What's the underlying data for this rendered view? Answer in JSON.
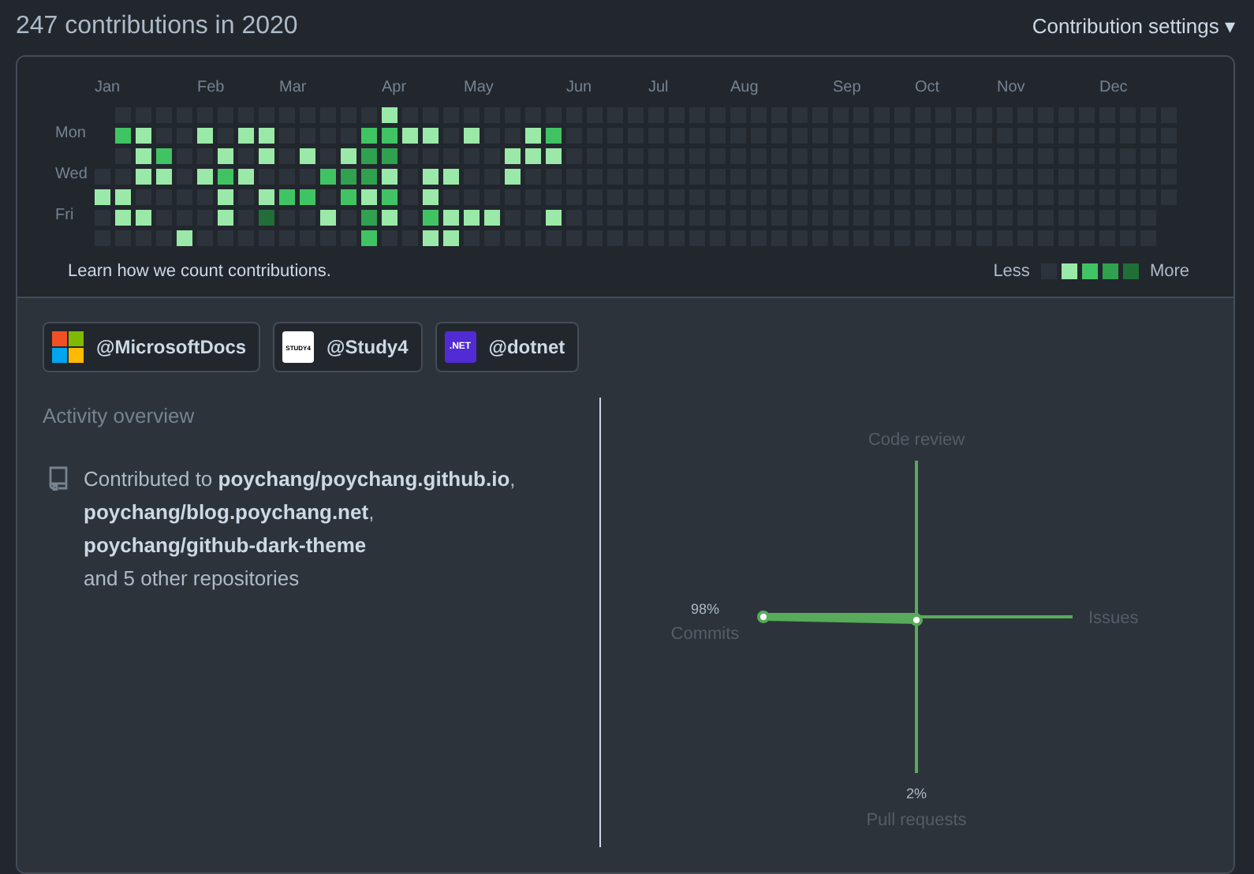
{
  "title": "247 contributions in 2020",
  "settings": {
    "label": "Contribution settings",
    "caret": "▾"
  },
  "calendar": {
    "day_labels": [
      "Mon",
      "Wed",
      "Fri"
    ],
    "weeks": [
      {
        "month": "Jan",
        "days": [
          {
            "color": "#2d333b"
          },
          {
            "color": "#9be9a8"
          },
          {
            "color": "#2d333b"
          },
          {
            "color": "#2d333b"
          }
        ]
      },
      {
        "days": [
          {
            "color": "#2d333b"
          },
          {
            "color": "#40c463"
          },
          {
            "color": "#2d333b"
          },
          {
            "color": "#2d333b"
          },
          {
            "color": "#9be9a8"
          },
          {
            "color": "#9be9a8"
          },
          {
            "color": "#2d333b"
          }
        ]
      },
      {
        "days": [
          {
            "color": "#2d333b"
          },
          {
            "color": "#9be9a8"
          },
          {
            "color": "#9be9a8"
          },
          {
            "color": "#9be9a8"
          },
          {
            "color": "#2d333b"
          },
          {
            "color": "#9be9a8"
          },
          {
            "color": "#2d333b"
          }
        ]
      },
      {
        "days": [
          {
            "color": "#2d333b"
          },
          {
            "color": "#2d333b"
          },
          {
            "color": "#40c463"
          },
          {
            "color": "#9be9a8"
          },
          {
            "color": "#2d333b"
          },
          {
            "color": "#2d333b"
          },
          {
            "color": "#2d333b"
          }
        ]
      },
      {
        "days": [
          {
            "color": "#2d333b"
          },
          {
            "color": "#2d333b"
          },
          {
            "color": "#2d333b"
          },
          {
            "color": "#2d333b"
          },
          {
            "color": "#2d333b"
          },
          {
            "color": "#2d333b"
          },
          {
            "color": "#9be9a8"
          }
        ]
      },
      {
        "month": "Feb",
        "days": [
          {
            "color": "#2d333b"
          },
          {
            "color": "#9be9a8"
          },
          {
            "color": "#2d333b"
          },
          {
            "color": "#9be9a8"
          },
          {
            "color": "#2d333b"
          },
          {
            "color": "#2d333b"
          },
          {
            "color": "#2d333b"
          }
        ]
      },
      {
        "days": [
          {
            "color": "#2d333b"
          },
          {
            "color": "#2d333b"
          },
          {
            "color": "#9be9a8"
          },
          {
            "color": "#40c463"
          },
          {
            "color": "#9be9a8"
          },
          {
            "color": "#9be9a8"
          },
          {
            "color": "#2d333b"
          }
        ]
      },
      {
        "days": [
          {
            "color": "#2d333b"
          },
          {
            "color": "#9be9a8"
          },
          {
            "color": "#2d333b"
          },
          {
            "color": "#9be9a8"
          },
          {
            "color": "#2d333b"
          },
          {
            "color": "#2d333b"
          },
          {
            "color": "#2d333b"
          }
        ]
      },
      {
        "days": [
          {
            "color": "#2d333b"
          },
          {
            "color": "#9be9a8"
          },
          {
            "color": "#9be9a8"
          },
          {
            "color": "#2d333b"
          },
          {
            "color": "#9be9a8"
          },
          {
            "color": "#216e39"
          },
          {
            "color": "#2d333b"
          }
        ]
      },
      {
        "month": "Mar",
        "days": [
          {
            "color": "#2d333b"
          },
          {
            "color": "#2d333b"
          },
          {
            "color": "#2d333b"
          },
          {
            "color": "#2d333b"
          },
          {
            "color": "#40c463"
          },
          {
            "color": "#2d333b"
          },
          {
            "color": "#2d333b"
          }
        ]
      },
      {
        "days": [
          {
            "color": "#2d333b"
          },
          {
            "color": "#2d333b"
          },
          {
            "color": "#9be9a8"
          },
          {
            "color": "#2d333b"
          },
          {
            "color": "#40c463"
          },
          {
            "color": "#2d333b"
          },
          {
            "color": "#2d333b"
          }
        ]
      },
      {
        "days": [
          {
            "color": "#2d333b"
          },
          {
            "color": "#2d333b"
          },
          {
            "color": "#2d333b"
          },
          {
            "color": "#40c463"
          },
          {
            "color": "#2d333b"
          },
          {
            "color": "#9be9a8"
          },
          {
            "color": "#2d333b"
          }
        ]
      },
      {
        "days": [
          {
            "color": "#2d333b"
          },
          {
            "color": "#2d333b"
          },
          {
            "color": "#9be9a8"
          },
          {
            "color": "#30a14e"
          },
          {
            "color": "#40c463"
          },
          {
            "color": "#2d333b"
          },
          {
            "color": "#2d333b"
          }
        ]
      },
      {
        "days": [
          {
            "color": "#2d333b"
          },
          {
            "color": "#40c463"
          },
          {
            "color": "#30a14e"
          },
          {
            "color": "#30a14e"
          },
          {
            "color": "#9be9a8"
          },
          {
            "color": "#30a14e"
          },
          {
            "color": "#40c463"
          }
        ]
      },
      {
        "month": "Apr",
        "days": [
          {
            "color": "#9be9a8"
          },
          {
            "color": "#40c463"
          },
          {
            "color": "#30a14e"
          },
          {
            "color": "#9be9a8"
          },
          {
            "color": "#40c463"
          },
          {
            "color": "#9be9a8"
          },
          {
            "color": "#2d333b"
          }
        ]
      },
      {
        "days": [
          {
            "color": "#2d333b"
          },
          {
            "color": "#9be9a8"
          },
          {
            "color": "#2d333b"
          },
          {
            "color": "#2d333b"
          },
          {
            "color": "#2d333b"
          },
          {
            "color": "#2d333b"
          },
          {
            "color": "#2d333b"
          }
        ]
      },
      {
        "days": [
          {
            "color": "#2d333b"
          },
          {
            "color": "#9be9a8"
          },
          {
            "color": "#2d333b"
          },
          {
            "color": "#9be9a8"
          },
          {
            "color": "#9be9a8"
          },
          {
            "color": "#40c463"
          },
          {
            "color": "#9be9a8"
          }
        ]
      },
      {
        "days": [
          {
            "color": "#2d333b"
          },
          {
            "color": "#2d333b"
          },
          {
            "color": "#2d333b"
          },
          {
            "color": "#9be9a8"
          },
          {
            "color": "#2d333b"
          },
          {
            "color": "#9be9a8"
          },
          {
            "color": "#9be9a8"
          }
        ]
      },
      {
        "month": "May",
        "days": [
          {
            "color": "#2d333b"
          },
          {
            "color": "#9be9a8"
          },
          {
            "color": "#2d333b"
          },
          {
            "color": "#2d333b"
          },
          {
            "color": "#2d333b"
          },
          {
            "color": "#9be9a8"
          },
          {
            "color": "#2d333b"
          }
        ]
      },
      {
        "days": [
          {
            "color": "#2d333b"
          },
          {
            "color": "#2d333b"
          },
          {
            "color": "#2d333b"
          },
          {
            "color": "#2d333b"
          },
          {
            "color": "#2d333b"
          },
          {
            "color": "#9be9a8"
          },
          {
            "color": "#2d333b"
          }
        ]
      },
      {
        "days": [
          {
            "color": "#2d333b"
          },
          {
            "color": "#2d333b"
          },
          {
            "color": "#9be9a8"
          },
          {
            "color": "#9be9a8"
          },
          {
            "color": "#2d333b"
          },
          {
            "color": "#2d333b"
          },
          {
            "color": "#2d333b"
          }
        ]
      },
      {
        "days": [
          {
            "color": "#2d333b"
          },
          {
            "color": "#9be9a8"
          },
          {
            "color": "#9be9a8"
          },
          {
            "color": "#2d333b"
          },
          {
            "color": "#2d333b"
          },
          {
            "color": "#2d333b"
          },
          {
            "color": "#2d333b"
          }
        ]
      },
      {
        "days": [
          {
            "color": "#2d333b"
          },
          {
            "color": "#40c463"
          },
          {
            "color": "#9be9a8"
          },
          {
            "color": "#2d333b"
          },
          {
            "color": "#2d333b"
          },
          {
            "color": "#9be9a8"
          },
          {
            "color": "#2d333b"
          }
        ]
      },
      {
        "month": "Jun",
        "days": [
          {
            "color": "#2d333b"
          },
          {
            "color": "#2d333b"
          },
          {
            "color": "#2d333b"
          },
          {
            "color": "#2d333b"
          },
          {
            "color": "#2d333b"
          },
          {
            "color": "#2d333b"
          },
          {
            "color": "#2d333b"
          }
        ]
      },
      {
        "days": [
          {
            "color": "#2d333b"
          },
          {
            "color": "#2d333b"
          },
          {
            "color": "#2d333b"
          },
          {
            "color": "#2d333b"
          },
          {
            "color": "#2d333b"
          },
          {
            "color": "#2d333b"
          },
          {
            "color": "#2d333b"
          }
        ]
      },
      {
        "days": [
          {
            "color": "#2d333b"
          },
          {
            "color": "#2d333b"
          },
          {
            "color": "#2d333b"
          },
          {
            "color": "#2d333b"
          },
          {
            "color": "#2d333b"
          },
          {
            "color": "#2d333b"
          },
          {
            "color": "#2d333b"
          }
        ]
      },
      {
        "days": [
          {
            "color": "#2d333b"
          },
          {
            "color": "#2d333b"
          },
          {
            "color": "#2d333b"
          },
          {
            "color": "#2d333b"
          },
          {
            "color": "#2d333b"
          },
          {
            "color": "#2d333b"
          },
          {
            "color": "#2d333b"
          }
        ]
      },
      {
        "month": "Jul",
        "days": [
          {
            "color": "#2d333b"
          },
          {
            "color": "#2d333b"
          },
          {
            "color": "#2d333b"
          },
          {
            "color": "#2d333b"
          },
          {
            "color": "#2d333b"
          },
          {
            "color": "#2d333b"
          },
          {
            "color": "#2d333b"
          }
        ]
      },
      {
        "days": [
          {
            "color": "#2d333b"
          },
          {
            "color": "#2d333b"
          },
          {
            "color": "#2d333b"
          },
          {
            "color": "#2d333b"
          },
          {
            "color": "#2d333b"
          },
          {
            "color": "#2d333b"
          },
          {
            "color": "#2d333b"
          }
        ]
      },
      {
        "days": [
          {
            "color": "#2d333b"
          },
          {
            "color": "#2d333b"
          },
          {
            "color": "#2d333b"
          },
          {
            "color": "#2d333b"
          },
          {
            "color": "#2d333b"
          },
          {
            "color": "#2d333b"
          },
          {
            "color": "#2d333b"
          }
        ]
      },
      {
        "days": [
          {
            "color": "#2d333b"
          },
          {
            "color": "#2d333b"
          },
          {
            "color": "#2d333b"
          },
          {
            "color": "#2d333b"
          },
          {
            "color": "#2d333b"
          },
          {
            "color": "#2d333b"
          },
          {
            "color": "#2d333b"
          }
        ]
      },
      {
        "month": "Aug",
        "days": [
          {
            "color": "#2d333b"
          },
          {
            "color": "#2d333b"
          },
          {
            "color": "#2d333b"
          },
          {
            "color": "#2d333b"
          },
          {
            "color": "#2d333b"
          },
          {
            "color": "#2d333b"
          },
          {
            "color": "#2d333b"
          }
        ]
      },
      {
        "days": [
          {
            "color": "#2d333b"
          },
          {
            "color": "#2d333b"
          },
          {
            "color": "#2d333b"
          },
          {
            "color": "#2d333b"
          },
          {
            "color": "#2d333b"
          },
          {
            "color": "#2d333b"
          },
          {
            "color": "#2d333b"
          }
        ]
      },
      {
        "days": [
          {
            "color": "#2d333b"
          },
          {
            "color": "#2d333b"
          },
          {
            "color": "#2d333b"
          },
          {
            "color": "#2d333b"
          },
          {
            "color": "#2d333b"
          },
          {
            "color": "#2d333b"
          },
          {
            "color": "#2d333b"
          }
        ]
      },
      {
        "days": [
          {
            "color": "#2d333b"
          },
          {
            "color": "#2d333b"
          },
          {
            "color": "#2d333b"
          },
          {
            "color": "#2d333b"
          },
          {
            "color": "#2d333b"
          },
          {
            "color": "#2d333b"
          },
          {
            "color": "#2d333b"
          }
        ]
      },
      {
        "days": [
          {
            "color": "#2d333b"
          },
          {
            "color": "#2d333b"
          },
          {
            "color": "#2d333b"
          },
          {
            "color": "#2d333b"
          },
          {
            "color": "#2d333b"
          },
          {
            "color": "#2d333b"
          },
          {
            "color": "#2d333b"
          }
        ]
      },
      {
        "month": "Sep",
        "days": [
          {
            "color": "#2d333b"
          },
          {
            "color": "#2d333b"
          },
          {
            "color": "#2d333b"
          },
          {
            "color": "#2d333b"
          },
          {
            "color": "#2d333b"
          },
          {
            "color": "#2d333b"
          },
          {
            "color": "#2d333b"
          }
        ]
      },
      {
        "days": [
          {
            "color": "#2d333b"
          },
          {
            "color": "#2d333b"
          },
          {
            "color": "#2d333b"
          },
          {
            "color": "#2d333b"
          },
          {
            "color": "#2d333b"
          },
          {
            "color": "#2d333b"
          },
          {
            "color": "#2d333b"
          }
        ]
      },
      {
        "days": [
          {
            "color": "#2d333b"
          },
          {
            "color": "#2d333b"
          },
          {
            "color": "#2d333b"
          },
          {
            "color": "#2d333b"
          },
          {
            "color": "#2d333b"
          },
          {
            "color": "#2d333b"
          },
          {
            "color": "#2d333b"
          }
        ]
      },
      {
        "days": [
          {
            "color": "#2d333b"
          },
          {
            "color": "#2d333b"
          },
          {
            "color": "#2d333b"
          },
          {
            "color": "#2d333b"
          },
          {
            "color": "#2d333b"
          },
          {
            "color": "#2d333b"
          },
          {
            "color": "#2d333b"
          }
        ]
      },
      {
        "month": "Oct",
        "days": [
          {
            "color": "#2d333b"
          },
          {
            "color": "#2d333b"
          },
          {
            "color": "#2d333b"
          },
          {
            "color": "#2d333b"
          },
          {
            "color": "#2d333b"
          },
          {
            "color": "#2d333b"
          },
          {
            "color": "#2d333b"
          }
        ]
      },
      {
        "days": [
          {
            "color": "#2d333b"
          },
          {
            "color": "#2d333b"
          },
          {
            "color": "#2d333b"
          },
          {
            "color": "#2d333b"
          },
          {
            "color": "#2d333b"
          },
          {
            "color": "#2d333b"
          },
          {
            "color": "#2d333b"
          }
        ]
      },
      {
        "days": [
          {
            "color": "#2d333b"
          },
          {
            "color": "#2d333b"
          },
          {
            "color": "#2d333b"
          },
          {
            "color": "#2d333b"
          },
          {
            "color": "#2d333b"
          },
          {
            "color": "#2d333b"
          },
          {
            "color": "#2d333b"
          }
        ]
      },
      {
        "days": [
          {
            "color": "#2d333b"
          },
          {
            "color": "#2d333b"
          },
          {
            "color": "#2d333b"
          },
          {
            "color": "#2d333b"
          },
          {
            "color": "#2d333b"
          },
          {
            "color": "#2d333b"
          },
          {
            "color": "#2d333b"
          }
        ]
      },
      {
        "month": "Nov",
        "days": [
          {
            "color": "#2d333b"
          },
          {
            "color": "#2d333b"
          },
          {
            "color": "#2d333b"
          },
          {
            "color": "#2d333b"
          },
          {
            "color": "#2d333b"
          },
          {
            "color": "#2d333b"
          },
          {
            "color": "#2d333b"
          }
        ]
      },
      {
        "days": [
          {
            "color": "#2d333b"
          },
          {
            "color": "#2d333b"
          },
          {
            "color": "#2d333b"
          },
          {
            "color": "#2d333b"
          },
          {
            "color": "#2d333b"
          },
          {
            "color": "#2d333b"
          },
          {
            "color": "#2d333b"
          }
        ]
      },
      {
        "days": [
          {
            "color": "#2d333b"
          },
          {
            "color": "#2d333b"
          },
          {
            "color": "#2d333b"
          },
          {
            "color": "#2d333b"
          },
          {
            "color": "#2d333b"
          },
          {
            "color": "#2d333b"
          },
          {
            "color": "#2d333b"
          }
        ]
      },
      {
        "days": [
          {
            "color": "#2d333b"
          },
          {
            "color": "#2d333b"
          },
          {
            "color": "#2d333b"
          },
          {
            "color": "#2d333b"
          },
          {
            "color": "#2d333b"
          },
          {
            "color": "#2d333b"
          },
          {
            "color": "#2d333b"
          }
        ]
      },
      {
        "days": [
          {
            "color": "#2d333b"
          },
          {
            "color": "#2d333b"
          },
          {
            "color": "#2d333b"
          },
          {
            "color": "#2d333b"
          },
          {
            "color": "#2d333b"
          },
          {
            "color": "#2d333b"
          },
          {
            "color": "#2d333b"
          }
        ]
      },
      {
        "month": "Dec",
        "days": [
          {
            "color": "#2d333b"
          },
          {
            "color": "#2d333b"
          },
          {
            "color": "#2d333b"
          },
          {
            "color": "#2d333b"
          },
          {
            "color": "#2d333b"
          },
          {
            "color": "#2d333b"
          },
          {
            "color": "#2d333b"
          }
        ]
      },
      {
        "days": [
          {
            "color": "#2d333b"
          },
          {
            "color": "#2d333b"
          },
          {
            "color": "#2d333b"
          },
          {
            "color": "#2d333b"
          },
          {
            "color": "#2d333b"
          },
          {
            "color": "#2d333b"
          },
          {
            "color": "#2d333b"
          }
        ]
      },
      {
        "days": [
          {
            "color": "#2d333b"
          },
          {
            "color": "#2d333b"
          },
          {
            "color": "#2d333b"
          },
          {
            "color": "#2d333b"
          },
          {
            "color": "#2d333b"
          },
          {
            "color": "#2d333b"
          },
          {
            "color": "#2d333b"
          }
        ]
      },
      {
        "days": [
          {
            "color": "#2d333b"
          },
          {
            "color": "#2d333b"
          },
          {
            "color": "#2d333b"
          },
          {
            "color": "#2d333b"
          },
          {
            "color": "#2d333b"
          }
        ]
      }
    ]
  },
  "learn_link": "Learn how we count contributions.",
  "legend": {
    "less": "Less",
    "more": "More",
    "swatches": [
      {
        "color": "#2d333b"
      },
      {
        "color": "#9be9a8"
      },
      {
        "color": "#40c463"
      },
      {
        "color": "#30a14e"
      },
      {
        "color": "#216e39"
      }
    ]
  },
  "orgs": [
    {
      "name": "@MicrosoftDocs",
      "logo": {
        "kind": "tiles"
      }
    },
    {
      "name": "@Study4",
      "logo": {
        "kind": "text",
        "text": "STUDY4",
        "color": "#ffffff"
      }
    },
    {
      "name": "@dotnet",
      "logo": {
        "kind": "text",
        "text": ".NET",
        "color": "#512bd4"
      }
    }
  ],
  "activity": {
    "heading": "Activity overview",
    "lines": [
      "Contributed to **poychang/poychang.github.io**,",
      "**poychang/blog.poychang.net**,",
      "**poychang/github-dark-theme**",
      "and 5 other repositories"
    ],
    "axes": [
      {
        "label": "Code review"
      },
      {
        "label": "Issues"
      },
      {
        "label": "Pull requests",
        "value": "2%"
      },
      {
        "label": "Commits",
        "value": "98%"
      }
    ]
  }
}
